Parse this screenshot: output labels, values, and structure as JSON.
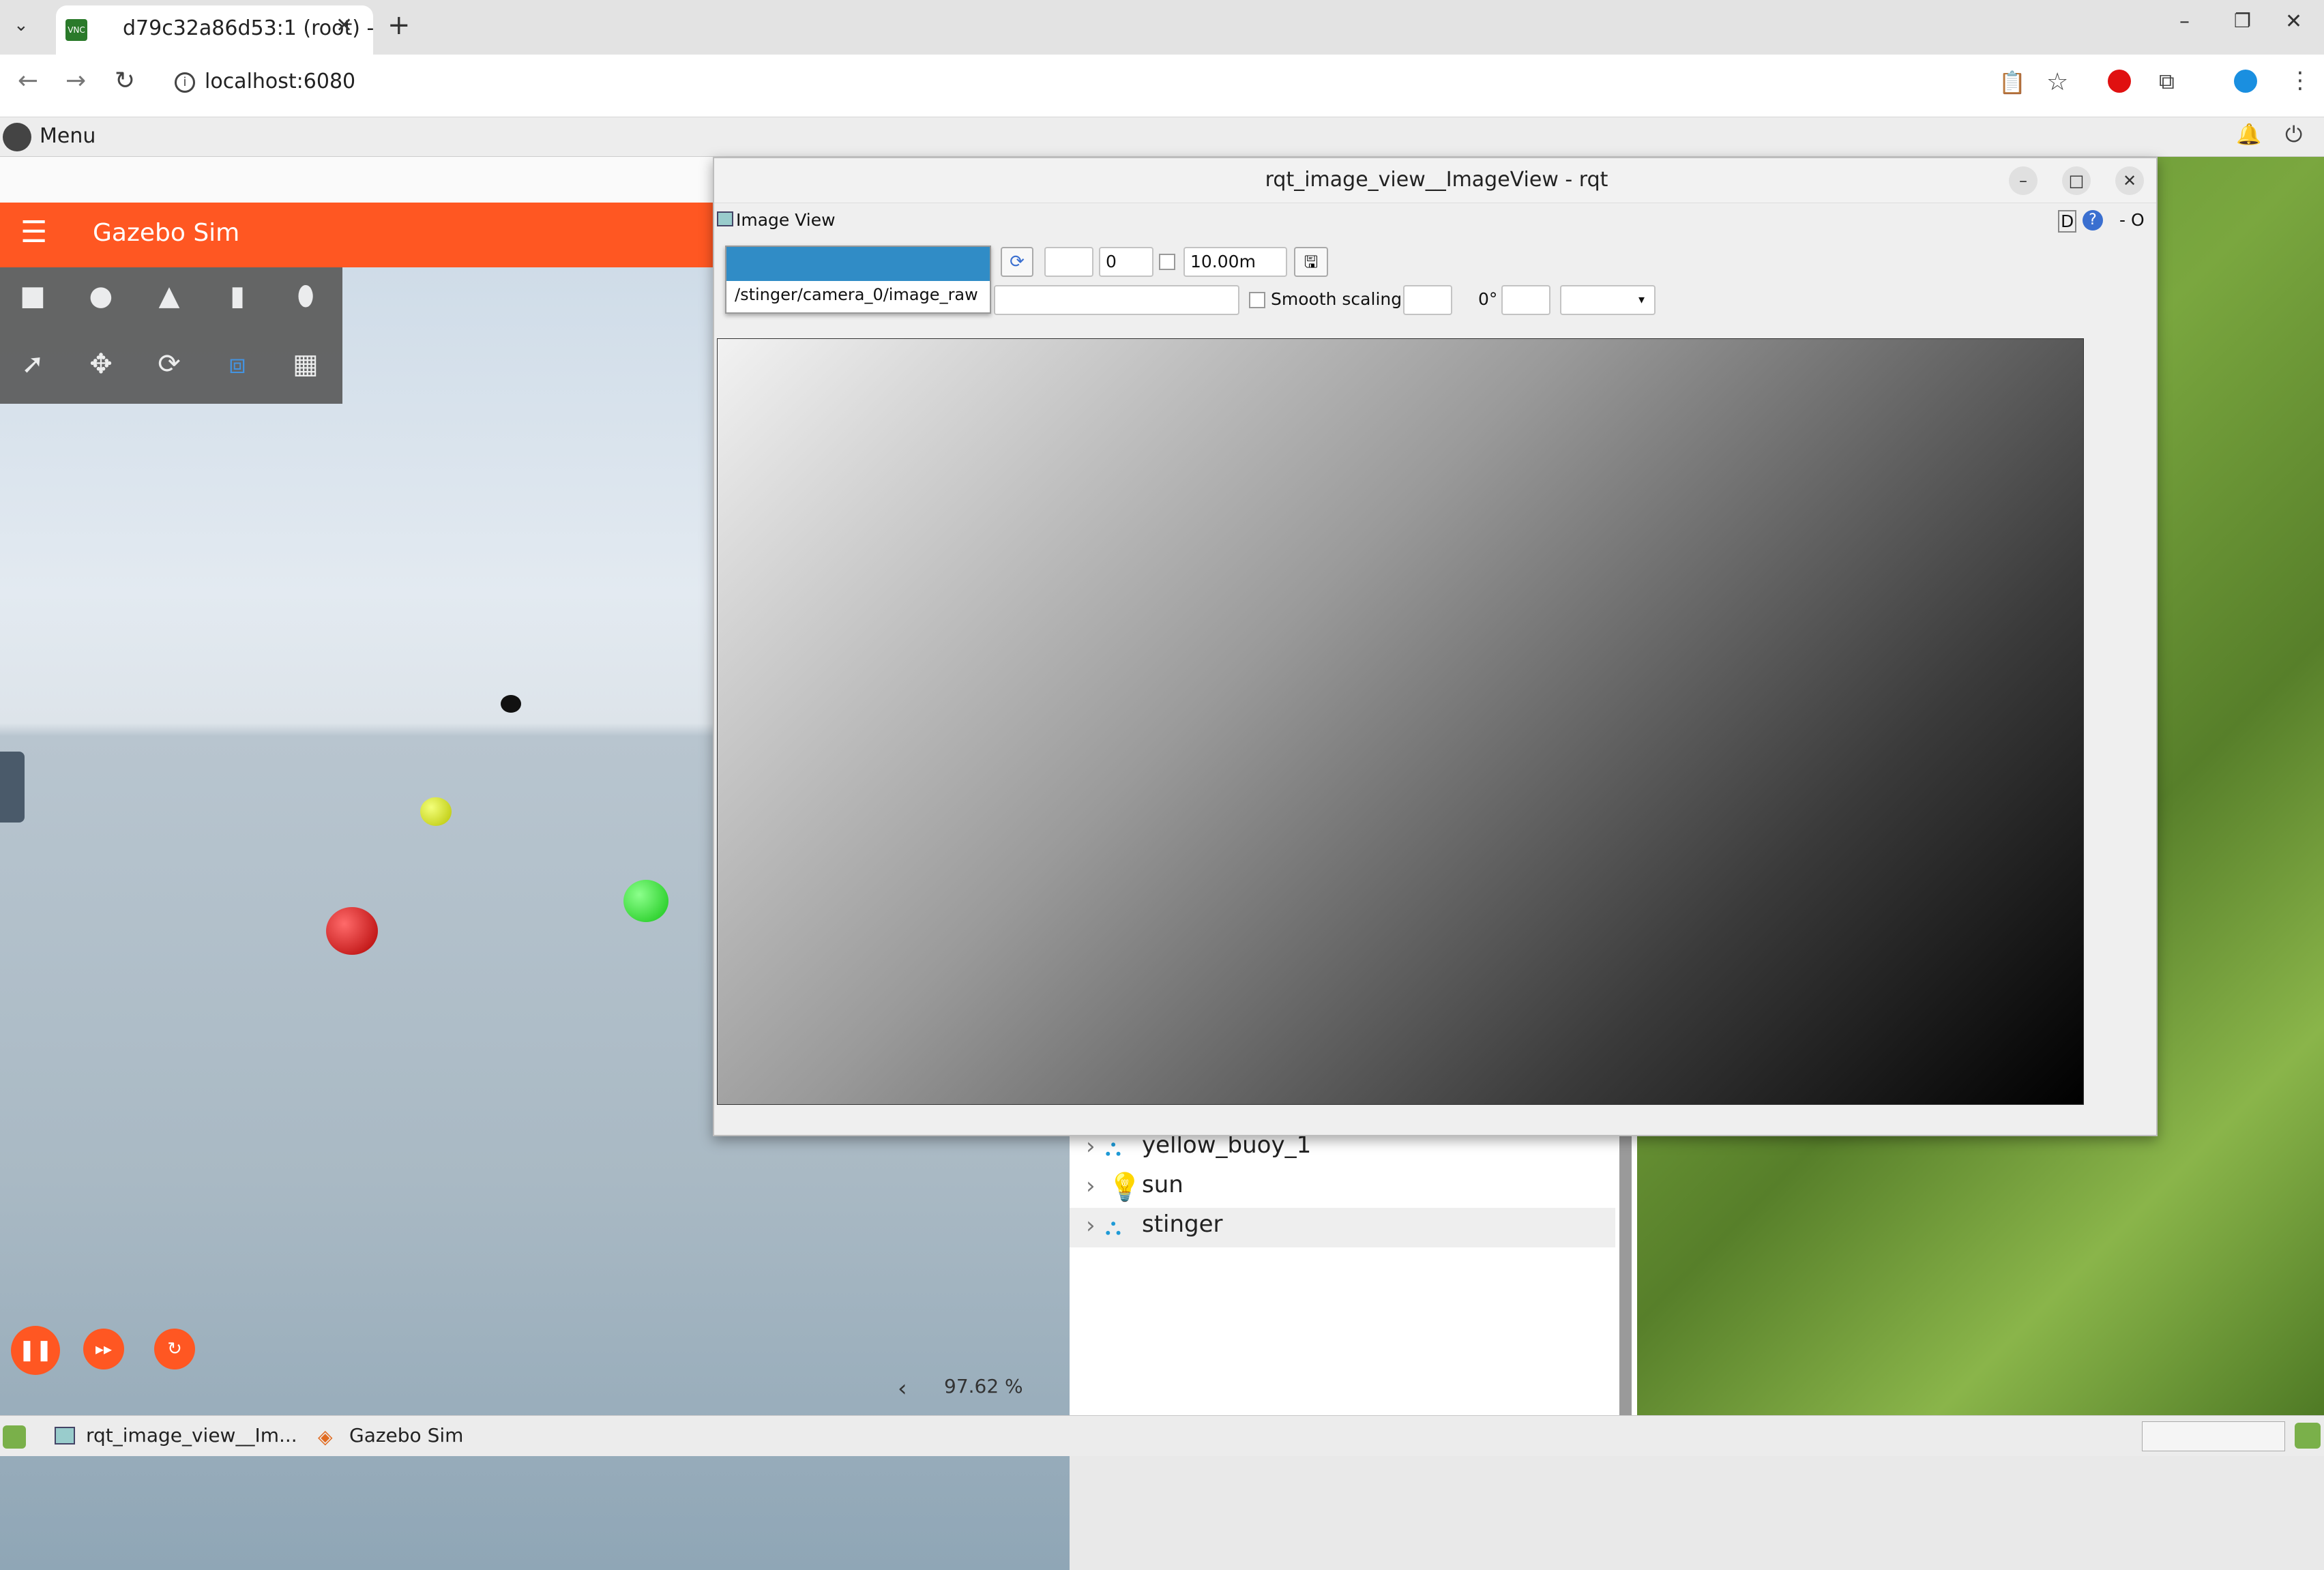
{
  "browser": {
    "tab_title": "d79c32a86d53:1 (root) -",
    "url": "localhost:6080"
  },
  "desktop": {
    "menu_label": "Menu"
  },
  "gazebo": {
    "title": "Gazebo Sim",
    "zoom_readout": "97.62 %",
    "entities": [
      "yellow_buoy_1",
      "sun",
      "stinger"
    ]
  },
  "rqt": {
    "window_title": "rqt_image_view__ImageView - rqt",
    "plugin_title": "Image View",
    "dropdown_option": "/stinger/camera_0/image_raw",
    "spin_value": "0",
    "range_value": "10.00m",
    "smooth_scaling_label": "Smooth scaling",
    "rotation_label": "0°",
    "header_right": "D",
    "header_dash": "- O"
  },
  "taskbar": {
    "items": [
      "rqt_image_view__Im...",
      "Gazebo Sim"
    ]
  }
}
